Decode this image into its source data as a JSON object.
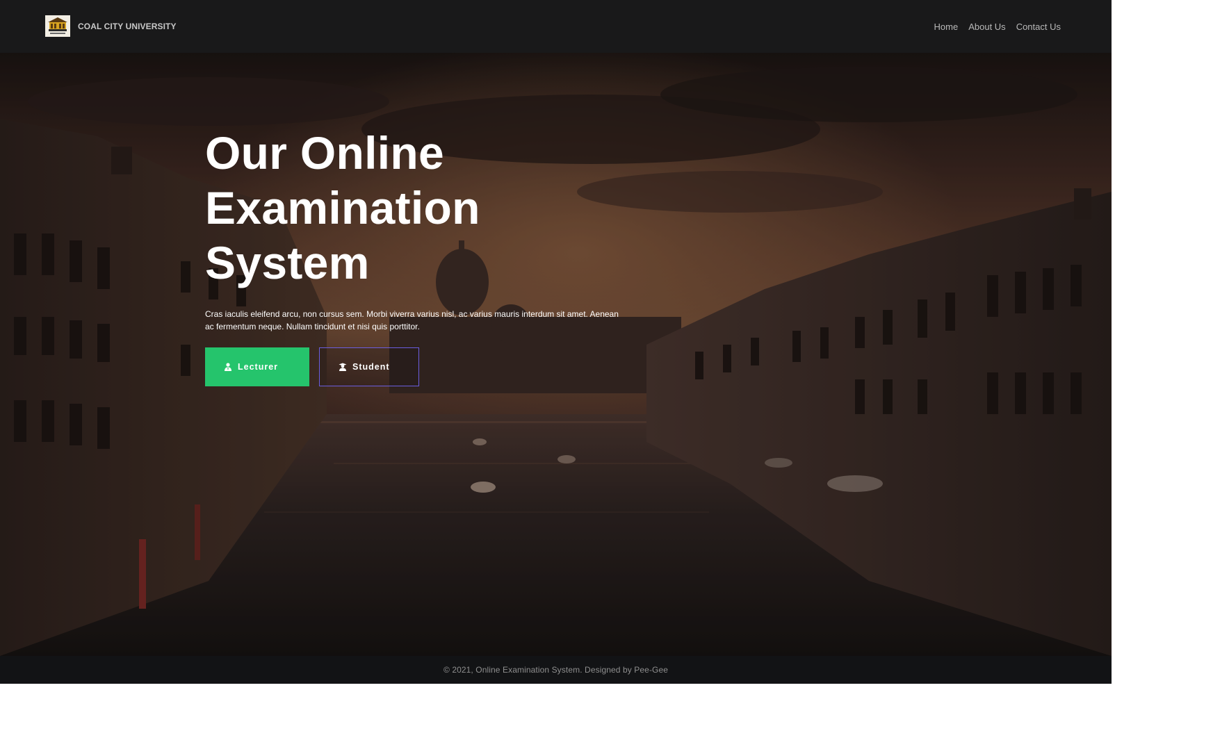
{
  "brand": {
    "name": "COAL CITY UNIVERSITY",
    "logo_icon": "university-crest-logo"
  },
  "nav": {
    "items": [
      {
        "label": "Home"
      },
      {
        "label": "About Us"
      },
      {
        "label": "Contact Us"
      }
    ]
  },
  "hero": {
    "title_line1": "Our Online",
    "title_line2": "Examination",
    "title_line3": "System",
    "text": "Cras iaculis eleifend arcu, non cursus sem. Morbi viverra varius nisl, ac varius mauris interdum sit amet. Aenean ac fermentum neque. Nullam tincidunt et nisi quis porttitor.",
    "background": "venice-grand-canal-sunset-photo",
    "buttons": {
      "lecturer": {
        "label": "Lecturer",
        "icon": "user-tie-icon",
        "color": "#25c46c"
      },
      "student": {
        "label": "Student",
        "icon": "user-graduate-icon",
        "border_color": "#6b5ee0"
      }
    }
  },
  "footer": {
    "text": "© 2021, Online Examination System. Designed by Pee-Gee"
  }
}
